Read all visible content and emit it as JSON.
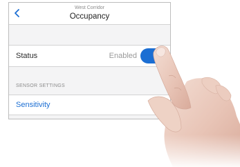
{
  "header": {
    "subtitle": "West Corridor",
    "title": "Occupancy",
    "back_icon": "chevron-left-icon"
  },
  "status_row": {
    "label": "Status",
    "value": "Enabled",
    "toggle_on": true,
    "toggle_color": "#1b6ed3"
  },
  "sensor_settings": {
    "header": "SENSOR SETTINGS",
    "items": [
      {
        "label": "Sensitivity"
      }
    ]
  },
  "colors": {
    "accent": "#1b6ed3",
    "background": "#f4f4f5"
  }
}
